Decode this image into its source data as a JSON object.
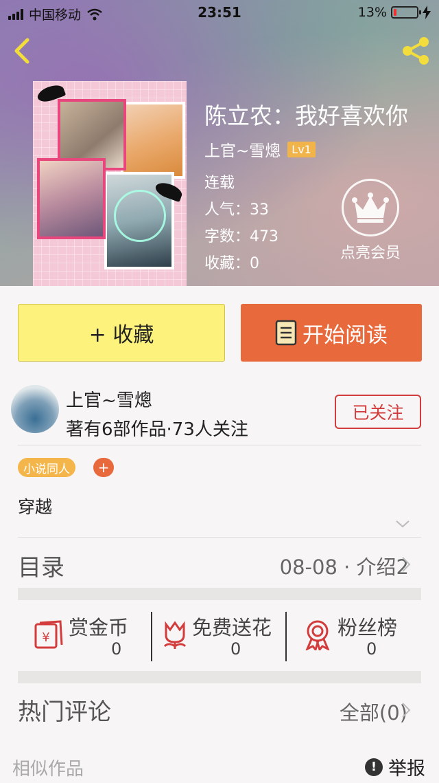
{
  "status_bar": {
    "carrier": "中国移动",
    "time": "23:51",
    "battery": "13%",
    "battery_level": 0.13
  },
  "book": {
    "title": "陈立农：我好喜欢你",
    "author": "上官~雪熜",
    "level": "Lv1",
    "status": "连载",
    "popularity": "人气：33",
    "word_count": "字数：473",
    "favorites": "收藏：0"
  },
  "vip": {
    "label": "点亮会员"
  },
  "actions": {
    "collect": "+ 收藏",
    "read": "开始阅读"
  },
  "author_card": {
    "name": "上官~雪熜",
    "stats": "著有6部作品·73人关注",
    "follow": "已关注"
  },
  "tags": {
    "primary": "小说同人",
    "add": "+"
  },
  "genre": "穿越",
  "toc": {
    "label": "目录",
    "value": "08-08 · 介绍2"
  },
  "stats": [
    {
      "name": "赏金币",
      "value": "0"
    },
    {
      "name": "免费送花",
      "value": "0"
    },
    {
      "name": "粉丝榜",
      "value": "0"
    }
  ],
  "comments": {
    "label": "热门评论",
    "all": "全部(0)"
  },
  "footer": {
    "similar": "相似作品",
    "report": "举报"
  },
  "colors": {
    "collect_bg": "#fdf37c",
    "read_bg": "#e86a3c",
    "follow": "#d23c3c",
    "tag": "#f4b64a",
    "level": "#f0b44a"
  }
}
